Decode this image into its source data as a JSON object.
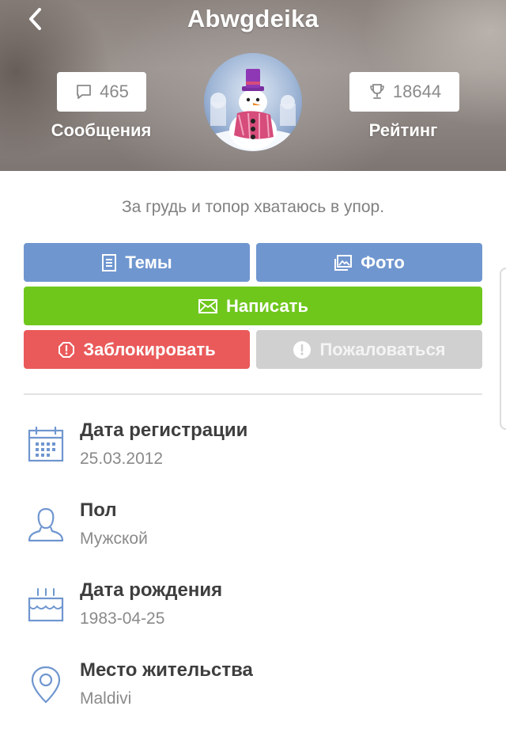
{
  "header": {
    "title": "Abwgdeika",
    "messages_count": "465",
    "messages_label": "Сообщения",
    "rating_count": "18644",
    "rating_label": "Рейтинг"
  },
  "status_text": "За грудь и топор хватаюсь в упор.",
  "buttons": {
    "themes": "Темы",
    "photo": "Фото",
    "write": "Написать",
    "block": "Заблокировать",
    "report": "Пожаловаться"
  },
  "colors": {
    "primary_blue": "#6f96cf",
    "write_green": "#6fc71c",
    "block_red": "#ea5a5a",
    "report_gray": "#d0d0d0",
    "icon_blue": "#6f96cf"
  },
  "info": [
    {
      "icon": "calendar-icon",
      "label": "Дата регистрации",
      "value": "25.03.2012"
    },
    {
      "icon": "person-icon",
      "label": "Пол",
      "value": "Мужской"
    },
    {
      "icon": "birthday-cake-icon",
      "label": "Дата рождения",
      "value": "1983-04-25"
    },
    {
      "icon": "location-pin-icon",
      "label": "Место жительства",
      "value": "Maldivi"
    }
  ]
}
